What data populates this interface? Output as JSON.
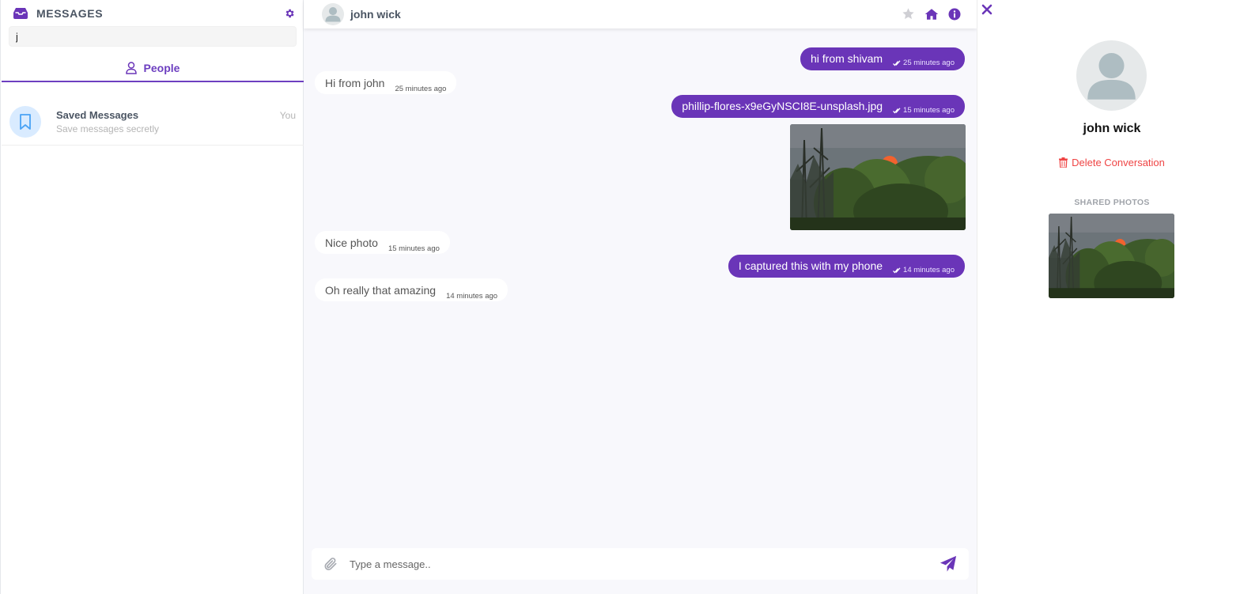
{
  "colors": {
    "accent": "#6a35b8",
    "danger": "#ef4444",
    "muted": "#b5b5b5"
  },
  "sidebar": {
    "title": "MESSAGES",
    "search_value": "j",
    "tab_label": "People",
    "items": [
      {
        "name": "Saved Messages",
        "subtitle": "Save messages secretly",
        "meta": "You",
        "icon": "bookmark-icon"
      }
    ]
  },
  "chat": {
    "contact_name": "john wick",
    "messages": [
      {
        "dir": "out",
        "text": "hi from shivam",
        "time": "25 minutes ago"
      },
      {
        "dir": "in",
        "text": "Hi from john",
        "time": "25 minutes ago"
      },
      {
        "dir": "out",
        "text": "phillip-flores-x9eGyNSCI8E-unsplash.jpg",
        "time": "15 minutes ago",
        "has_image": true
      },
      {
        "dir": "in",
        "text": "Nice photo",
        "time": "15 minutes ago"
      },
      {
        "dir": "out",
        "text": "I captured this with my phone",
        "time": "14 minutes ago"
      },
      {
        "dir": "in",
        "text": "Oh really that amazing",
        "time": "14 minutes ago"
      }
    ],
    "composer_placeholder": "Type a message.."
  },
  "info_panel": {
    "name": "john wick",
    "delete_label": "Delete Conversation",
    "shared_title": "SHARED PHOTOS"
  }
}
